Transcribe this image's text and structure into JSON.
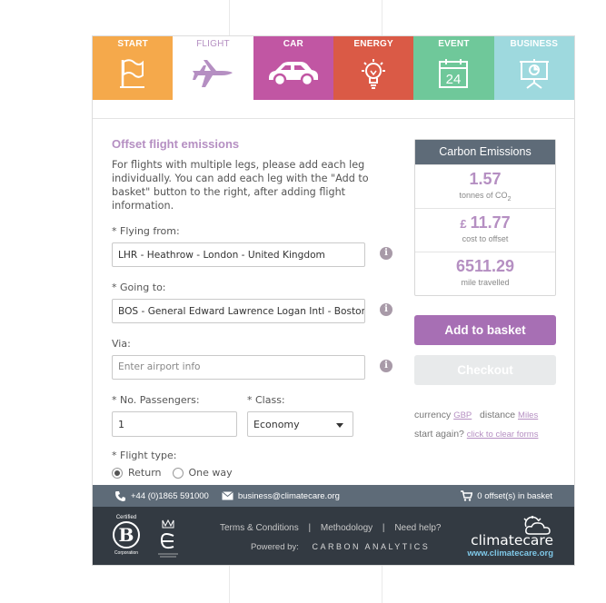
{
  "tabs": [
    {
      "label": "START",
      "color": "#f5a94b",
      "icon": "flag-icon"
    },
    {
      "label": "FLIGHT",
      "color": "#ffffff",
      "icon": "airplane-icon",
      "active": true
    },
    {
      "label": "CAR",
      "color": "#c156a3",
      "icon": "car-icon"
    },
    {
      "label": "ENERGY",
      "color": "#da5a46",
      "icon": "lightbulb-icon"
    },
    {
      "label": "EVENT",
      "color": "#6fc89a",
      "icon": "calendar-icon"
    },
    {
      "label": "BUSINESS",
      "color": "#9ed9de",
      "icon": "presentation-icon"
    }
  ],
  "calendar_day": "24",
  "form": {
    "title": "Offset flight emissions",
    "intro": "For flights with multiple legs, please add each leg individually. You can add each leg with the \"Add to basket\" button to the right, after adding flight information.",
    "from_label": "* Flying from:",
    "from_value": "LHR - Heathrow - London - United Kingdom",
    "to_label": "* Going to:",
    "to_value": "BOS - General Edward Lawrence Logan Intl - Boston",
    "via_label": "Via:",
    "via_placeholder": "Enter airport info",
    "info_glyph": "i",
    "passengers_label": "* No. Passengers:",
    "passengers_value": "1",
    "class_label": "* Class:",
    "class_value": "Economy",
    "flight_type_label": "* Flight type:",
    "flight_type_options": [
      "Return",
      "One way"
    ],
    "flight_type_selected": "Return"
  },
  "emissions": {
    "title": "Carbon Emissions",
    "tonnes_value": "1.57",
    "tonnes_label_pre": "tonnes of CO",
    "tonnes_label_sub": "2",
    "currency_symbol": "£",
    "cost_value": "11.77",
    "cost_label": "cost to offset",
    "miles_value": "6511.29",
    "miles_label": "mile travelled"
  },
  "buttons": {
    "add": "Add to basket",
    "checkout": "Checkout"
  },
  "meta": {
    "currency_label": "currency",
    "currency_value": "GBP",
    "distance_label": "distance",
    "distance_value": "Miles",
    "start_again_label": "start again?",
    "clear_link": "click to clear forms"
  },
  "footer": {
    "phone": "+44 (0)1865 591000",
    "email": "business@climatecare.org",
    "basket": "0 offset(s) in basket",
    "certified": "Certified",
    "b_letter": "B",
    "corporation": "Corporation",
    "terms": "Terms & Conditions",
    "sep": "|",
    "methodology": "Methodology",
    "help": "Need help?",
    "powered_by": "Powered by:",
    "carbon_analytics": "CARBON ANALYTICS",
    "brand": "climatecare",
    "url": "www.climatecare.org"
  }
}
